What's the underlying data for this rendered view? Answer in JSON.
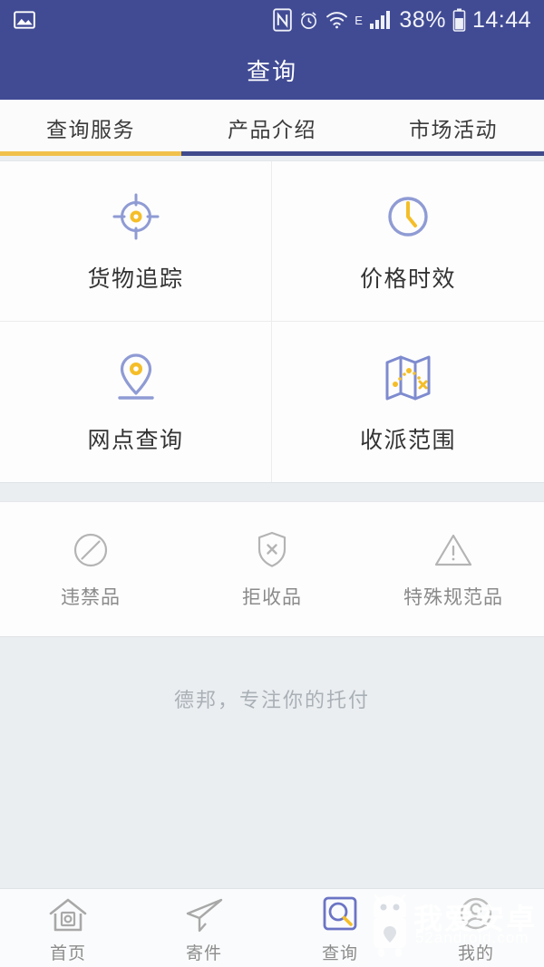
{
  "status_bar": {
    "left_icon": "image-icon",
    "icons": [
      "nfc-icon",
      "alarm-icon",
      "wifi-icon",
      "network-type",
      "signal-icon"
    ],
    "network_type": "E",
    "battery_percent": "38%",
    "time": "14:44"
  },
  "header": {
    "title": "查询",
    "bg_color": "#414b94"
  },
  "tabs": {
    "active_index": 0,
    "active_underline_color": "#f0c14b",
    "inactive_underline_color": "#404b8c",
    "items": [
      {
        "label": "查询服务"
      },
      {
        "label": "产品介绍"
      },
      {
        "label": "市场活动"
      }
    ]
  },
  "services": {
    "items": [
      {
        "label": "货物追踪",
        "icon": "target-icon"
      },
      {
        "label": "价格时效",
        "icon": "clock-icon"
      },
      {
        "label": "网点查询",
        "icon": "map-pin-icon"
      },
      {
        "label": "收派范围",
        "icon": "folded-map-icon"
      }
    ]
  },
  "notices": {
    "items": [
      {
        "label": "违禁品",
        "icon": "prohibited-icon"
      },
      {
        "label": "拒收品",
        "icon": "shield-x-icon"
      },
      {
        "label": "特殊规范品",
        "icon": "warning-triangle-icon"
      }
    ]
  },
  "tagline": "德邦，专注你的托付",
  "bottom_nav": {
    "active_index": 2,
    "items": [
      {
        "label": "首页",
        "icon": "home-icon"
      },
      {
        "label": "寄件",
        "icon": "paper-plane-icon"
      },
      {
        "label": "查询",
        "icon": "search-square-icon"
      },
      {
        "label": "我的",
        "icon": "user-circle-icon"
      }
    ]
  },
  "watermark": {
    "title": "我爱安卓",
    "url": "52android.com"
  },
  "colors": {
    "brand_blue": "#414b94",
    "accent_yellow": "#f0c14b",
    "icon_purple": "#8f9bd4",
    "page_bg": "#ebeef1",
    "card_bg": "#fdfdfd",
    "muted_gray": "#8a8a8a"
  }
}
